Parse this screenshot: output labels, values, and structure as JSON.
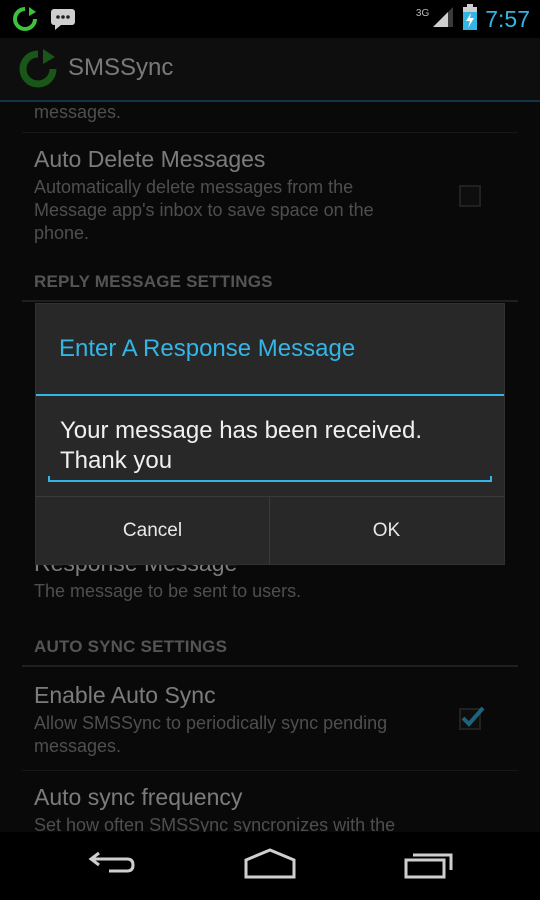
{
  "status_bar": {
    "network": "3G",
    "time": "7:57"
  },
  "action_bar": {
    "title": "SMSSync"
  },
  "preferences": {
    "partial_summary": "messages.",
    "auto_delete": {
      "title": "Auto Delete Messages",
      "summary": "Automatically delete messages from the Message app's inbox to save space on the phone.",
      "checked": false
    },
    "reply_category": "REPLY MESSAGE SETTINGS",
    "response_message": {
      "title": "Response Message",
      "summary": "The message to be sent to users."
    },
    "auto_sync_category": "AUTO SYNC SETTINGS",
    "enable_auto_sync": {
      "title": "Enable Auto Sync",
      "summary": "Allow SMSSync to periodically sync pending messages.",
      "checked": true
    },
    "auto_sync_frequency": {
      "title": "Auto sync frequency",
      "summary": "Set how often SMSSync syncronizes with the"
    }
  },
  "dialog": {
    "title": "Enter A Response Message",
    "input_value": "Your message has been received. Thank you",
    "cancel_label": "Cancel",
    "ok_label": "OK"
  },
  "colors": {
    "accent": "#33b5e5",
    "app_green": "#2e9e2e"
  },
  "icons": {
    "status_left": [
      "sync-notification-icon",
      "sms-notification-icon"
    ],
    "status_right": [
      "signal-icon",
      "battery-charging-icon"
    ],
    "nav": [
      "back-icon",
      "home-icon",
      "recent-apps-icon"
    ]
  }
}
